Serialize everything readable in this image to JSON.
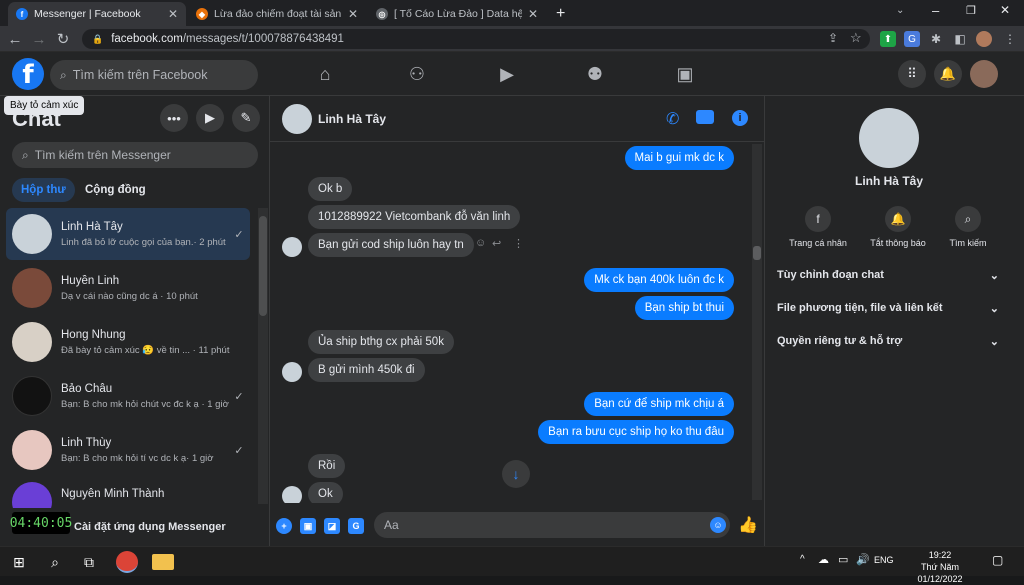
{
  "browser": {
    "tabs": [
      {
        "title": "Messenger | Facebook",
        "active": true,
        "icon": "facebook-icon"
      },
      {
        "title": "Lừa đảo chiếm đoạt tài sản trị giá",
        "active": false,
        "icon": "fire-icon"
      },
      {
        "title": "[ Tố Cáo Lừa Đảo ] Data hệ thống",
        "active": false,
        "icon": "globe-icon"
      }
    ],
    "url_host": "facebook.com",
    "url_path": "/messages/t/100078876438491"
  },
  "fb_header": {
    "logo": "f",
    "search_placeholder": "Tìm kiếm trên Facebook"
  },
  "left": {
    "tooltip": "Bày tỏ cảm xúc",
    "title": "Chat",
    "search_placeholder": "Tìm kiếm trên Messenger",
    "tabs": [
      "Hộp thư",
      "Cộng đồng"
    ],
    "conversations": [
      {
        "name": "Linh Hà Tây",
        "preview": "Linh đã bỏ lỡ cuộc gọi của bạn.· 2 phút",
        "active": true
      },
      {
        "name": "Huyền Linh",
        "preview": "Dạ v cái nào cũng dc á · 10 phút",
        "active": false
      },
      {
        "name": "Hong Nhung",
        "preview": "Đã bày tỏ cảm xúc 😥 về tin ... · 11 phút",
        "active": false
      },
      {
        "name": "Bảo Châu",
        "preview": "Bạn: B cho mk hỏi chút vc đc k ạ · 1 giờ",
        "active": false
      },
      {
        "name": "Linh Thùy",
        "preview": "Bạn: B cho mk hỏi tí vc dc k ạ· 1 giờ",
        "active": false
      },
      {
        "name": "Nguyễn Minh Thành",
        "preview": "",
        "active": false
      }
    ],
    "install_label": "Cài đặt ứng dụng Messenger",
    "clock": "04:40:05"
  },
  "chat": {
    "contact_name": "Linh Hà Tây",
    "composer_placeholder": "Aa",
    "messages": [
      {
        "text": "Mai b gui mk dc k",
        "dir": "out"
      },
      {
        "text": "Ok b",
        "dir": "in"
      },
      {
        "text": "1012889922 Vietcombank đỗ văn linh",
        "dir": "in"
      },
      {
        "text": "Bạn gửi cod ship luôn hay tn",
        "dir": "in"
      },
      {
        "text": "Mk ck bạn 400k luôn đc k",
        "dir": "out"
      },
      {
        "text": "Bạn ship bt thui",
        "dir": "out"
      },
      {
        "text": "Ủa ship bthg cx phải 50k",
        "dir": "in"
      },
      {
        "text": "B gửi mình 450k đi",
        "dir": "in"
      },
      {
        "text": "Bạn cứ để ship mk chịu á",
        "dir": "out"
      },
      {
        "text": "Bạn ra bưu cục ship họ ko thu đâu",
        "dir": "out"
      },
      {
        "text": "Rồi",
        "dir": "in"
      },
      {
        "text": "Ok",
        "dir": "in"
      }
    ]
  },
  "right": {
    "name": "Linh Hà Tây",
    "actions": [
      "Trang cá nhân",
      "Tắt thông báo",
      "Tìm kiếm"
    ],
    "sections": [
      "Tùy chỉnh đoạn chat",
      "File phương tiện, file và liên kết",
      "Quyền riêng tư & hỗ trợ"
    ]
  },
  "taskbar": {
    "time": "19:22",
    "date": "Thứ Năm 01/12/2022",
    "lang": "ENG"
  },
  "colors": {
    "accent": "#0a7cff",
    "fb_blue": "#1877f2",
    "bg": "#18191a",
    "panel": "#242526"
  }
}
